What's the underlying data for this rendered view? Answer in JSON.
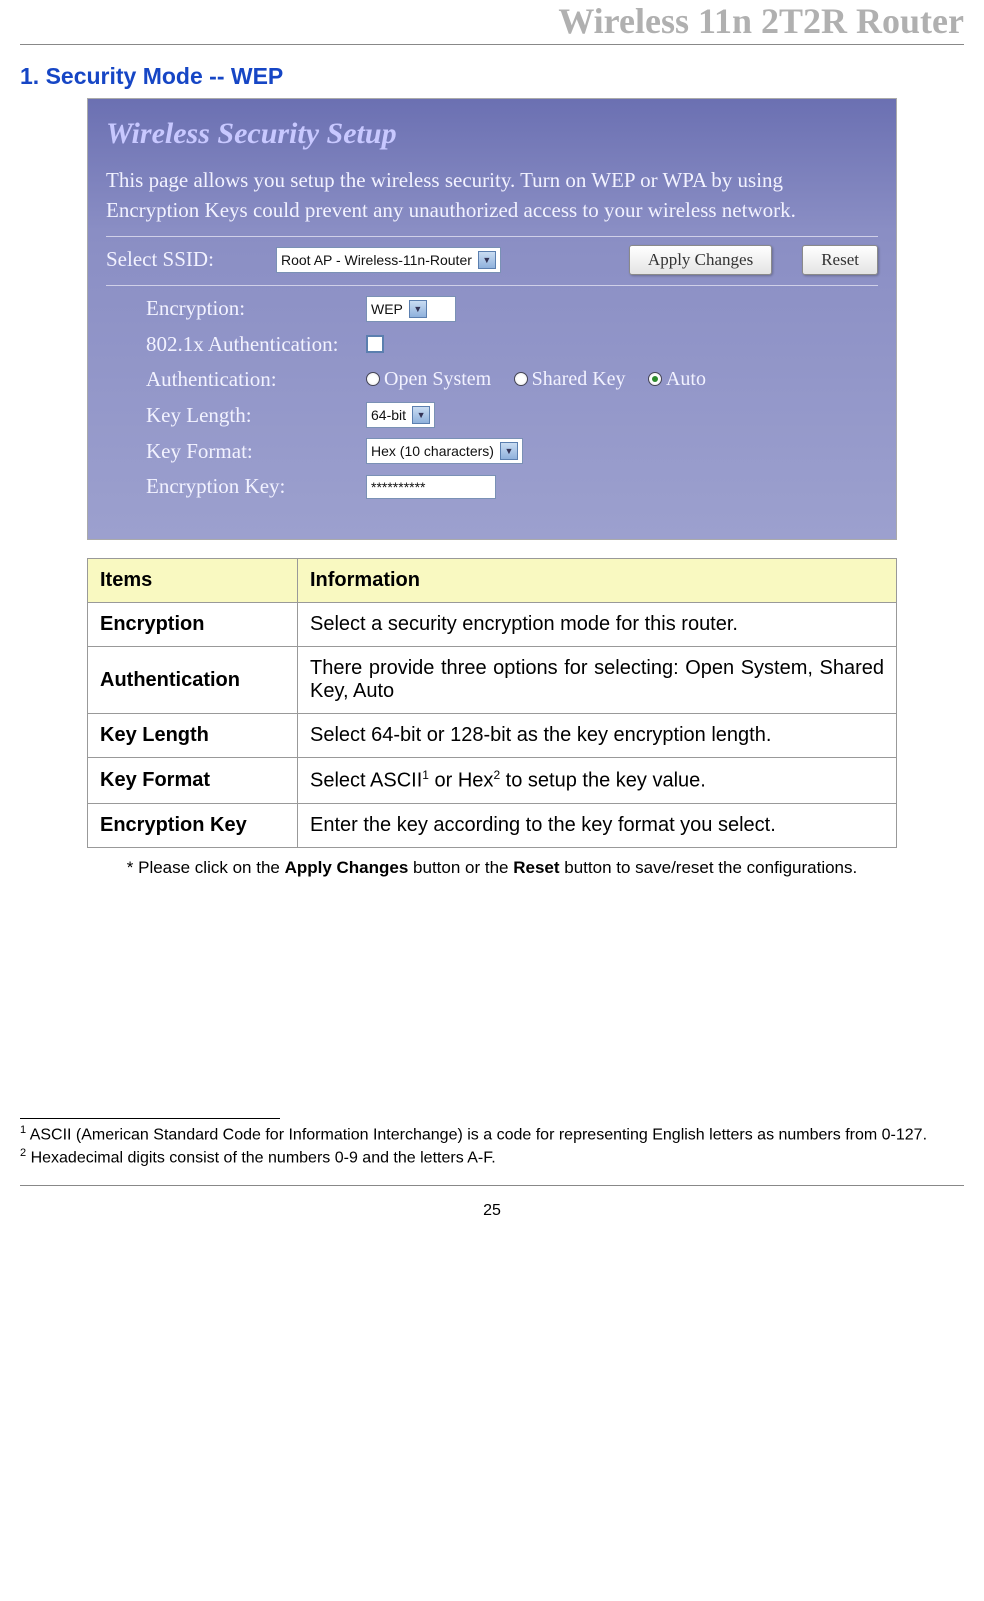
{
  "header": {
    "title": "Wireless 11n 2T2R Router"
  },
  "section": {
    "title": "1. Security Mode -- WEP"
  },
  "screenshot": {
    "title": "Wireless Security Setup",
    "description": "This page allows you setup the wireless security. Turn on WEP or WPA by using Encryption Keys could prevent any unauthorized access to your wireless network.",
    "ssid": {
      "label": "Select SSID:",
      "value": "Root AP - Wireless-11n-Router",
      "apply_btn": "Apply Changes",
      "reset_btn": "Reset"
    },
    "fields": {
      "encryption": {
        "label": "Encryption:",
        "value": "WEP"
      },
      "dot1x": {
        "label": "802.1x Authentication:",
        "checked": false
      },
      "auth": {
        "label": "Authentication:",
        "options": [
          "Open System",
          "Shared Key",
          "Auto"
        ],
        "selected": "Auto"
      },
      "keylen": {
        "label": "Key Length:",
        "value": "64-bit"
      },
      "keyfmt": {
        "label": "Key Format:",
        "value": "Hex (10 characters)"
      },
      "enckey": {
        "label": "Encryption Key:",
        "value": "**********"
      }
    }
  },
  "table": {
    "head_items": "Items",
    "head_info": "Information",
    "rows": [
      {
        "item": "Encryption",
        "info": "Select a security encryption mode for this router."
      },
      {
        "item": "Authentication",
        "info": "There provide three options for selecting: Open System, Shared Key, Auto"
      },
      {
        "item": "Key Length",
        "info": "Select 64-bit or 128-bit as the key encryption length."
      },
      {
        "item": "Key Format",
        "info_prefix": "Select ASCII",
        "info_mid": " or Hex",
        "info_suffix": " to setup the key value."
      },
      {
        "item": "Encryption Key",
        "info": "Enter the key according to the key format you select."
      }
    ]
  },
  "note": {
    "prefix": "* Please click on the ",
    "btn1": "Apply Changes",
    "mid": " button or the ",
    "btn2": "Reset",
    "suffix": " button to save/reset the configurations."
  },
  "footnotes": {
    "f1": "ASCII (American Standard Code for Information Interchange) is a code for representing English letters as numbers from 0-127.",
    "f2": "Hexadecimal digits consist of the numbers 0-9 and the letters A-F."
  },
  "page_number": "25"
}
